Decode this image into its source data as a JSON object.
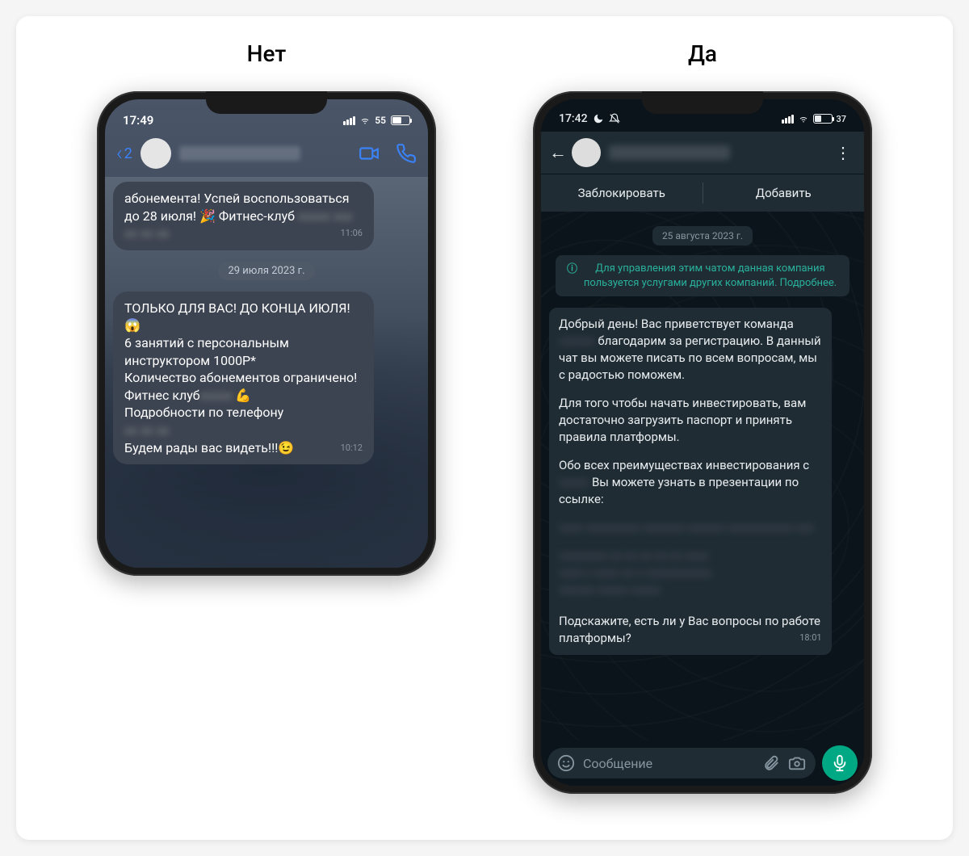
{
  "left": {
    "title": "Нет",
    "status": {
      "time": "17:49",
      "battery": "55"
    },
    "nav": {
      "back_count": "2"
    },
    "chat": {
      "bubble1": "абонемента! Успей воспользоваться до 28 июля! 🎉 Фитнес-клуб",
      "bubble1_time": "11:06",
      "date": "29 июля 2023 г.",
      "bubble2_l1": "ТОЛЬКО ДЛЯ ВАС! ДО КОНЦА ИЮЛЯ!😱",
      "bubble2_l2": "6 занятий с персональным инструктором 1000Р*",
      "bubble2_l3": "Количество абонементов ограничено!",
      "bubble2_l4": "Фитнес клуб",
      "bubble2_l4_emoji": " 💪",
      "bubble2_l5": "Подробности по телефону",
      "bubble2_l6": "Будем рады вас видеть!!!😉",
      "bubble2_time": "10:12"
    }
  },
  "right": {
    "title": "Да",
    "status": {
      "time": "17:42",
      "battery": "37"
    },
    "actions": {
      "block": "Заблокировать",
      "add": "Добавить"
    },
    "chat": {
      "date": "25 августа 2023 г.",
      "info": "Для управления этим чатом данная компания пользуется услугами других компаний. Подробнее.",
      "m1_p1a": "Добрый день! Вас приветствует команда ",
      "m1_p1b": " благодарим за регистрацию. В данный чат вы можете писать по всем вопросам, мы с радостью поможем.",
      "m1_p2": "Для того чтобы начать инвестировать, вам достаточно загрузить паспорт и принять правила платформы.",
      "m1_p3a": "Обо всех преимуществах инвестирования с ",
      "m1_p3b": " Вы можете узнать в презентации по ссылке:",
      "m1_p4": "Подскажите, есть ли у Вас вопросы по работе платформы?",
      "m1_time": "18:01"
    },
    "input": {
      "placeholder": "Сообщение"
    }
  }
}
